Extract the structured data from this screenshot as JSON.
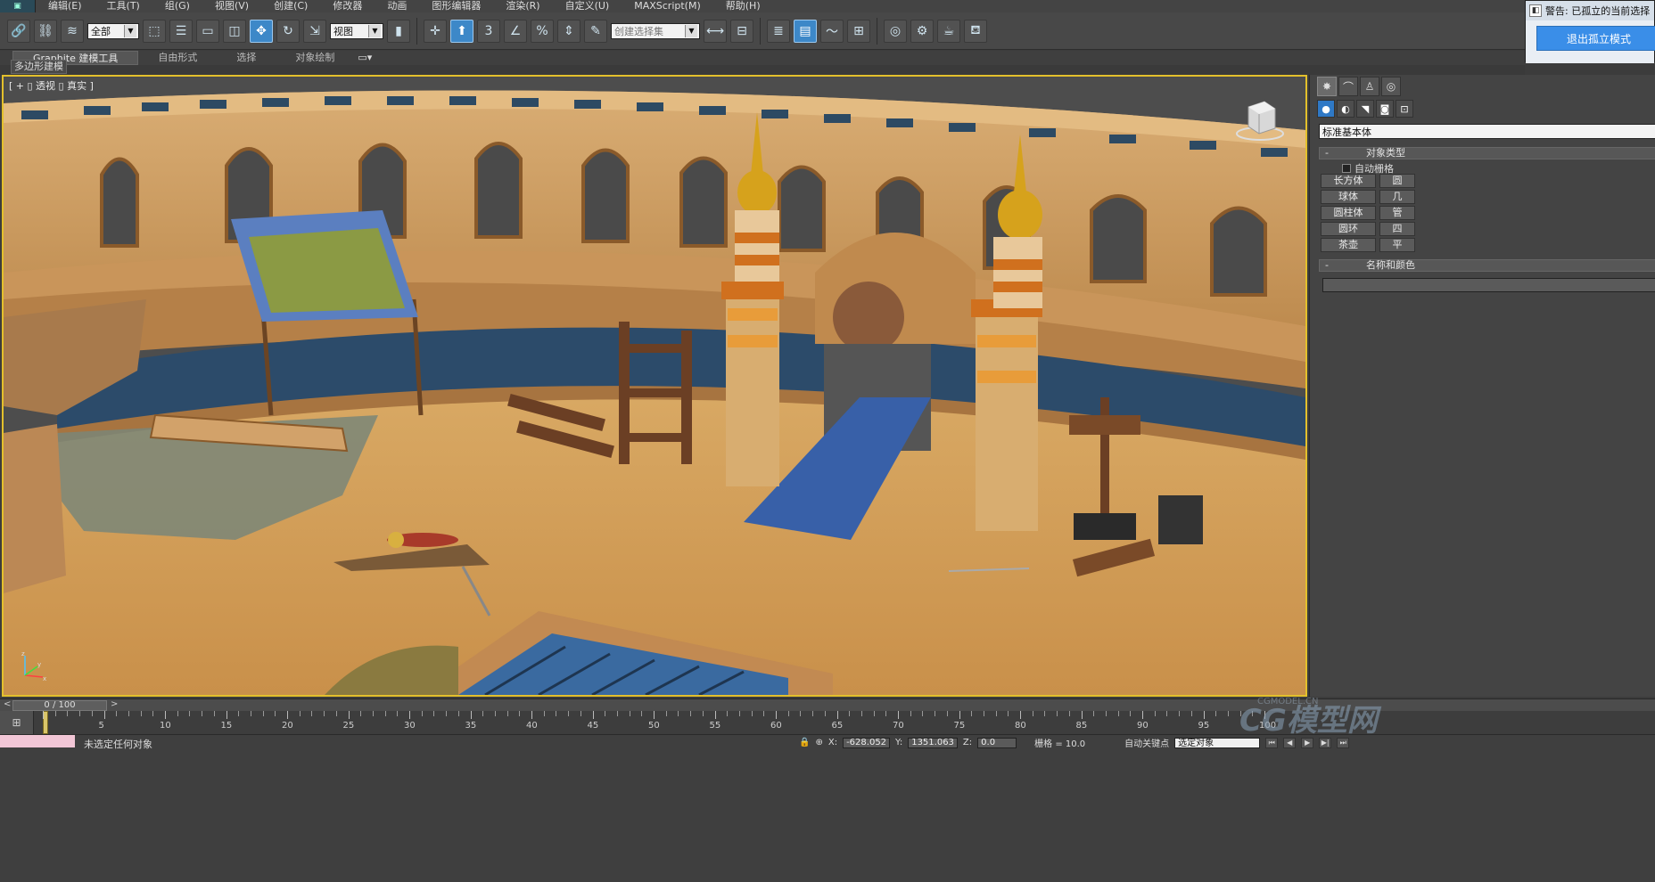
{
  "menu": {
    "items": [
      "编辑(E)",
      "工具(T)",
      "组(G)",
      "视图(V)",
      "创建(C)",
      "修改器",
      "动画",
      "图形编辑器",
      "渲染(R)",
      "自定义(U)",
      "MAXScript(M)",
      "帮助(H)"
    ]
  },
  "toolbar": {
    "selection_filter": "全部",
    "reference_coord": "视图",
    "named_selection_placeholder": "创建选择集",
    "snap_label": "3"
  },
  "warning": {
    "title": "警告: 已孤立的当前选择",
    "button": "退出孤立模式"
  },
  "ribbon": {
    "tabs": [
      "Graphite 建模工具",
      "自由形式",
      "选择",
      "对象绘制"
    ],
    "panel_label": "多边形建模"
  },
  "viewport": {
    "label": "[ + ] [ 透视 ] [ 真实 ]",
    "label_display": "[ + ▯ 透视 ▯ 真实 ]"
  },
  "command_panel": {
    "dropdown": "标准基本体",
    "object_type_title": "对象类型",
    "autogrid": "自动栅格",
    "objects": [
      "长方体",
      "球体",
      "圆柱体",
      "圆环",
      "茶壶"
    ],
    "objects_right": [
      "圆",
      "几",
      "管",
      "四",
      "平"
    ],
    "name_color_title": "名称和颜色"
  },
  "timeline": {
    "slider": "0 / 100",
    "ticks": [
      5,
      10,
      15,
      20,
      25,
      30,
      35,
      40,
      45,
      50,
      55,
      60,
      65,
      70,
      75,
      80,
      85,
      90,
      95,
      100
    ]
  },
  "status": {
    "text": "未选定任何对象",
    "x_label": "X:",
    "x_value": "-628.052",
    "y_label": "Y:",
    "y_value": "1351.063",
    "z_label": "Z:",
    "z_value": "0.0",
    "grid": "栅格 = 10.0",
    "autokey": "自动关键点",
    "select_mode": "选定对象"
  },
  "watermark": "CG模型网",
  "watermark_url": "CGMODEL.CN",
  "colors": {
    "viewport_border": "#e3c02c",
    "active_button": "#3d88c8",
    "exit_button": "#3a8ee8"
  }
}
